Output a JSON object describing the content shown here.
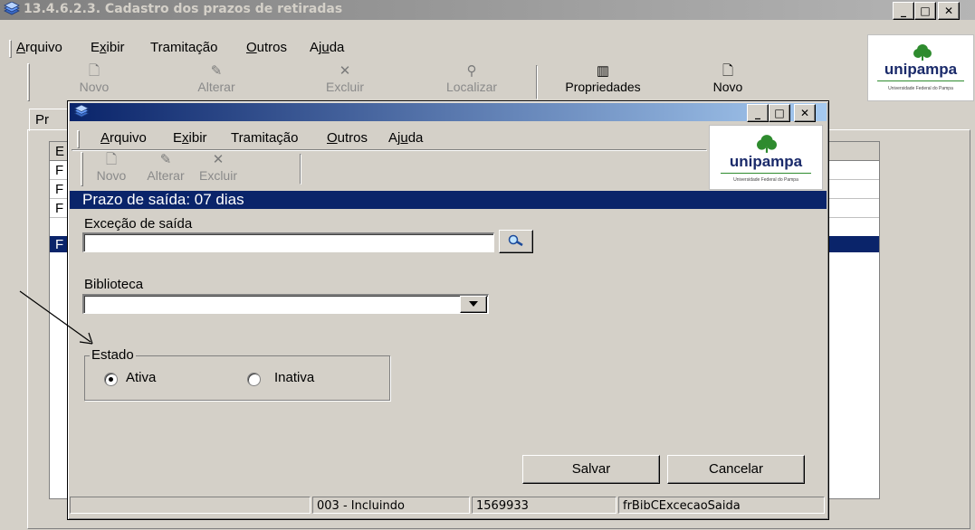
{
  "main_window": {
    "title": "13.4.6.2.3. Cadastro dos prazos de retiradas",
    "menu": [
      "Arquivo",
      "Exibir",
      "Tramitação",
      "Outros",
      "Ajuda"
    ],
    "toolbar": [
      {
        "label": "Novo",
        "icon": "new-document-icon",
        "enabled": false
      },
      {
        "label": "Alterar",
        "icon": "edit-icon",
        "enabled": false
      },
      {
        "label": "Excluir",
        "icon": "delete-x-icon",
        "enabled": false
      },
      {
        "label": "Localizar",
        "icon": "binoculars-icon",
        "enabled": false
      },
      {
        "label": "Propriedades",
        "icon": "properties-icon",
        "enabled": true
      },
      {
        "label": "Novo",
        "icon": "new-document-icon",
        "enabled": true
      }
    ],
    "tab_label": "Pr",
    "grid_first_col": [
      "E",
      "F",
      "F",
      "F",
      "F"
    ]
  },
  "logo": {
    "name": "unipampa",
    "subtitle": "Universidade Federal do Pampa"
  },
  "dialog": {
    "menu": [
      "Arquivo",
      "Exibir",
      "Tramitação",
      "Outros",
      "Ajuda"
    ],
    "toolbar": [
      {
        "label": "Novo",
        "icon": "new-document-icon"
      },
      {
        "label": "Alterar",
        "icon": "edit-icon"
      },
      {
        "label": "Excluir",
        "icon": "delete-x-icon"
      }
    ],
    "header": "Prazo de saída: 07 dias",
    "excecao_label": "Exceção de saída",
    "excecao_value": "",
    "biblioteca_label": "Biblioteca",
    "biblioteca_value": "",
    "estado_label": "Estado",
    "radio_ativa": "Ativa",
    "radio_inativa": "Inativa",
    "estado_selected": "Ativa",
    "salvar": "Salvar",
    "cancelar": "Cancelar",
    "status": [
      "",
      "003 - Incluindo",
      "1569933",
      "frBibCExcecaoSaida"
    ]
  },
  "colors": {
    "titlebar_active": "#0a246a",
    "titlebar_inactive": "#808080",
    "face": "#d4d0c8",
    "selection": "#0a246a"
  }
}
